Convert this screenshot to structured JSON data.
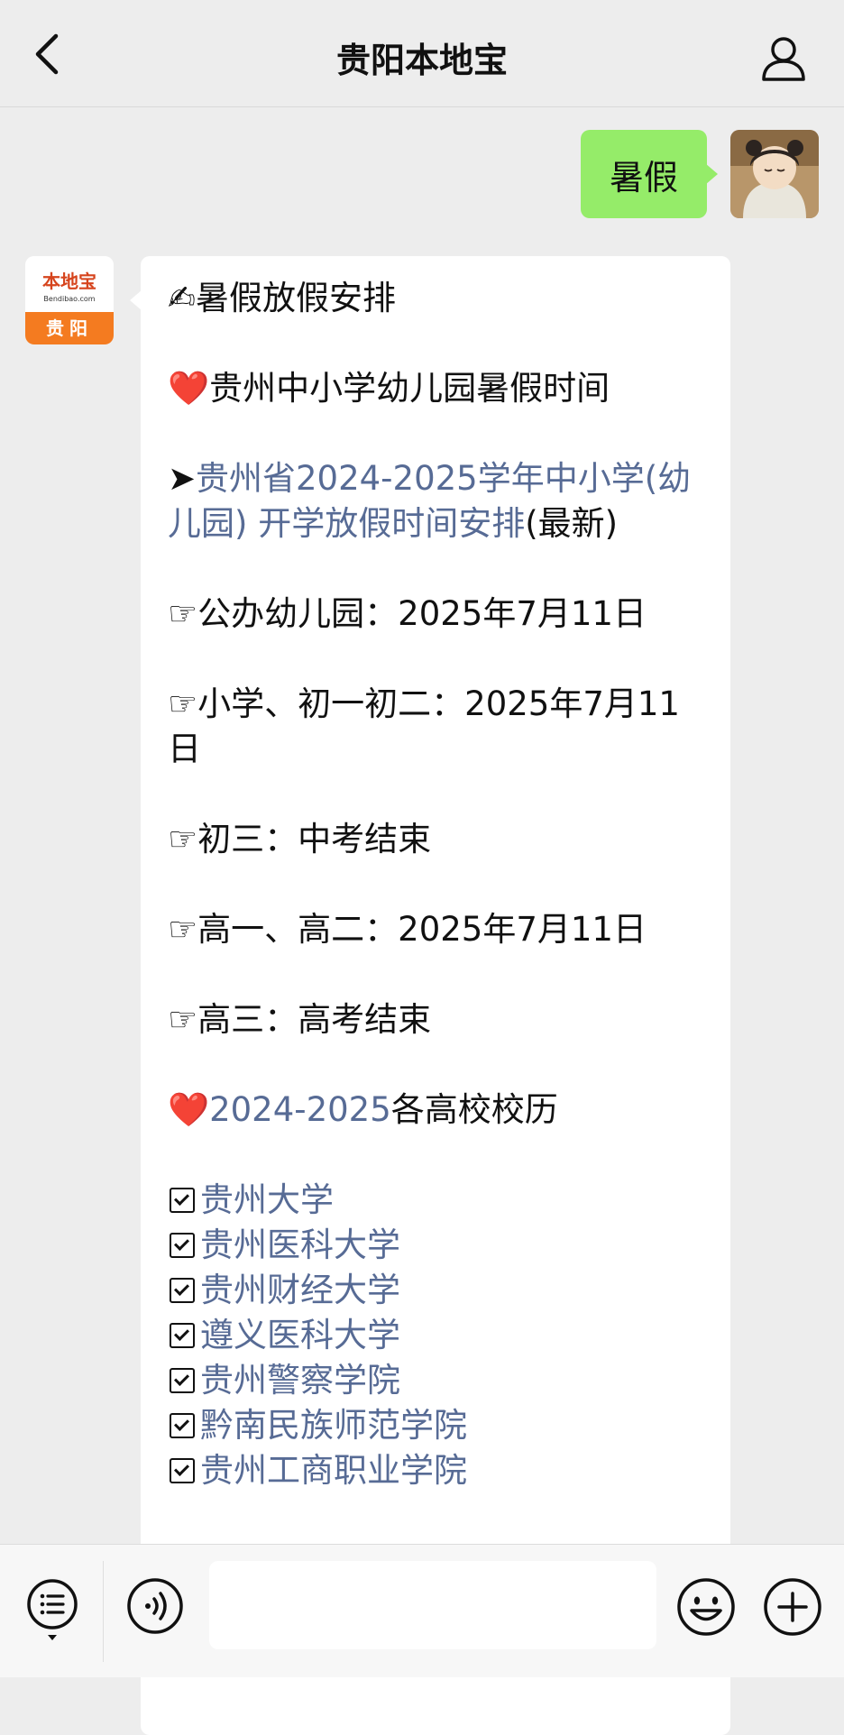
{
  "header": {
    "title": "贵阳本地宝",
    "back_icon": "chevron-left-icon",
    "user_icon": "person-icon"
  },
  "sent_message": {
    "text": "暑假"
  },
  "sender": {
    "logo_name": "本地宝",
    "logo_site": "Bendibao.com",
    "logo_city": "贵阳"
  },
  "reply": {
    "heading_emoji": "✍",
    "heading": "暑假放假安排",
    "section1_emoji": "❤️",
    "section1_title": "贵州中小学幼儿园暑假时间",
    "arrow": "➤",
    "link_text": "贵州省2024-2025学年中小学(幼儿园) 开学放假时间安排",
    "link_suffix": "(最新)",
    "items": [
      {
        "pointer": "☞",
        "text": "公办幼儿园：2025年7月11日"
      },
      {
        "pointer": "☞",
        "text": "小学、初一初二：2025年7月11日"
      },
      {
        "pointer": "☞",
        "text": "初三：中考结束"
      },
      {
        "pointer": "☞",
        "text": "高一、高二：2025年7月11日"
      },
      {
        "pointer": "☞",
        "text": "高三：高考结束"
      }
    ],
    "section2_emoji": "❤️",
    "section2_link": "2024-2025",
    "section2_rest": "各高校校历",
    "universities": [
      "贵州大学",
      "贵州医科大学",
      "贵州财经大学",
      "遵义医科大学",
      "贵州警察学院",
      "黔南民族师范学院",
      "贵州工商职业学院"
    ]
  },
  "toolbar": {
    "menu_icon": "list-menu-icon",
    "voice_icon": "voice-icon",
    "input_value": "",
    "emoji_icon": "smile-icon",
    "plus_icon": "plus-icon"
  },
  "colors": {
    "sent_bubble": "#95ec69",
    "link": "#576b95",
    "background": "#ededed",
    "logo_orange": "#f47b20"
  }
}
